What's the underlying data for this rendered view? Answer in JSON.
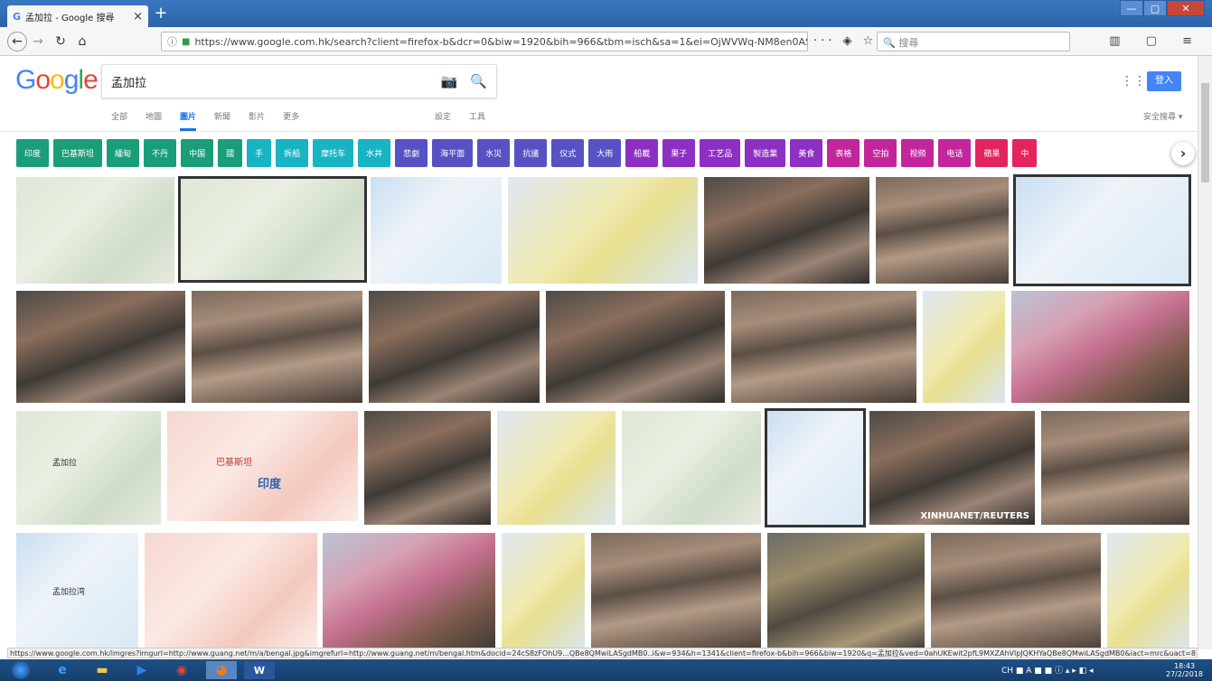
{
  "browser": {
    "tab_title": "孟加拉 - Google 搜尋",
    "tab_icon": "G",
    "new_tab": "+",
    "url": "https://www.google.com.hk/search?client=firefox-b&dcr=0&biw=1920&bih=966&tbm=isch&sa=1&ei=OjWVWq-NM8en0ASprbTYDg&q=孟加拉",
    "search_placeholder": "搜尋",
    "page_actions": "··· ◈ ☆",
    "toolbar_icons": "▥ ▢ ≡"
  },
  "google": {
    "logo": "Google",
    "query": "孟加拉",
    "signin": "登入",
    "tabs": [
      "全部",
      "地圖",
      "圖片",
      "新聞",
      "影片",
      "更多"
    ],
    "tools": [
      "設定",
      "工具"
    ],
    "safesearch": "安全搜尋 ▾"
  },
  "chips": [
    {
      "label": "印度",
      "color": "#1a9e7a"
    },
    {
      "label": "巴基斯坦",
      "color": "#1a9e7a"
    },
    {
      "label": "緬甸",
      "color": "#1a9e7a"
    },
    {
      "label": "不丹",
      "color": "#1a9e7a"
    },
    {
      "label": "中国",
      "color": "#1a9e7a"
    },
    {
      "label": "國",
      "color": "#1a9e7a"
    },
    {
      "label": "手",
      "color": "#17b4c4"
    },
    {
      "label": "拆船",
      "color": "#17b4c4"
    },
    {
      "label": "摩托车",
      "color": "#17b4c4"
    },
    {
      "label": "水井",
      "color": "#17b4c4"
    },
    {
      "label": "悲劇",
      "color": "#5751c4"
    },
    {
      "label": "海平面",
      "color": "#5751c4"
    },
    {
      "label": "水災",
      "color": "#5751c4"
    },
    {
      "label": "抗議",
      "color": "#5751c4"
    },
    {
      "label": "仪式",
      "color": "#5751c4"
    },
    {
      "label": "大雨",
      "color": "#5751c4"
    },
    {
      "label": "船載",
      "color": "#8e2fc3"
    },
    {
      "label": "果子",
      "color": "#8e2fc3"
    },
    {
      "label": "工艺品",
      "color": "#8e2fc3"
    },
    {
      "label": "製造業",
      "color": "#8e2fc3"
    },
    {
      "label": "美食",
      "color": "#8e2fc3"
    },
    {
      "label": "表格",
      "color": "#c3259c"
    },
    {
      "label": "空拍",
      "color": "#c3259c"
    },
    {
      "label": "视频",
      "color": "#c3259c"
    },
    {
      "label": "电话",
      "color": "#c3259c"
    },
    {
      "label": "蘋果",
      "color": "#e4245e"
    },
    {
      "label": "中",
      "color": "#e4245e"
    }
  ],
  "chip_next": "›",
  "thumbs_text": {
    "map_labels_a": [
      "印度",
      "孟加拉"
    ],
    "reuters": "XINHUANET/REUTERS",
    "pakistan": "巴基斯坦",
    "bay": "孟加拉湾"
  },
  "status_url": "https://www.google.com.hk/imgres?imgurl=http://www.guang.net/m/a/bengal.jpg&imgrefurl=http://www.guang.net/m/bengal.htm&docid=24cS8zFOhU9...QBe8QMwiLASgdMB0..i&w=934&h=1341&client=firefox-b&bih=966&biw=1920&q=孟加拉&ved=0ahUKEwit2pfL9MXZAhVlpJQKHYaQBe8QMwiLASgdMB0&iact=mrc&uact=8",
  "taskbar": {
    "tray": "CH ■ A ■ ■ ⓘ ▴ ▸ ◧ ◂",
    "time": "18:43",
    "date": "27/2/2018"
  },
  "window_controls": [
    "—",
    "▢",
    "✕"
  ]
}
